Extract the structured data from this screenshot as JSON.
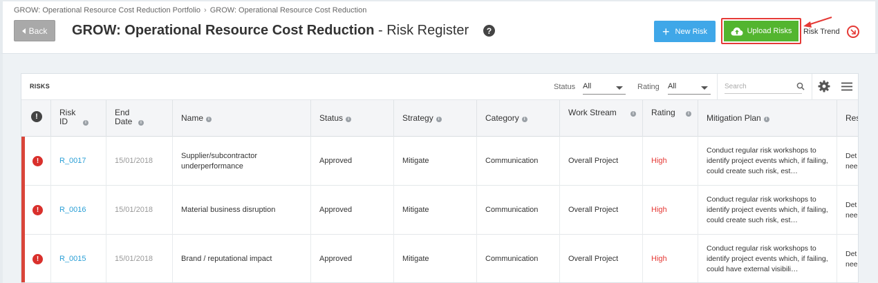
{
  "breadcrumb": [
    "GROW: Operational Resource Cost Reduction Portfolio",
    "GROW: Operational Resource Cost Reduction"
  ],
  "breadcrumb_sep": "›",
  "header": {
    "back_label": "Back",
    "title_bold": "GROW: Operational Resource Cost Reduction",
    "title_rest": " - Risk Register",
    "help_glyph": "?",
    "new_risk_label": "New Risk",
    "upload_label": "Upload Risks",
    "risk_trend_label": "Risk Trend"
  },
  "toolbar": {
    "risks_label": "RISKS",
    "status_label": "Status",
    "status_value": "All",
    "rating_label": "Rating",
    "rating_value": "All",
    "search_placeholder": "Search"
  },
  "columns": {
    "risk_id": "Risk ID",
    "end_date": "End Date",
    "name": "Name",
    "status": "Status",
    "strategy": "Strategy",
    "category": "Category",
    "work_stream": "Work Stream",
    "rating": "Rating",
    "mitigation": "Mitigation Plan",
    "res": "Res"
  },
  "rows": [
    {
      "id": "R_0017",
      "end_date": "15/01/2018",
      "name": "Supplier/subcontractor underperformance",
      "status": "Approved",
      "strategy": "Mitigate",
      "category": "Communication",
      "work_stream": "Overall Project",
      "rating": "High",
      "mitigation": "Conduct regular risk workshops to identify project events which, if failing, could create such risk, est…",
      "res": "Det nee"
    },
    {
      "id": "R_0016",
      "end_date": "15/01/2018",
      "name": "Material business disruption",
      "status": "Approved",
      "strategy": "Mitigate",
      "category": "Communication",
      "work_stream": "Overall Project",
      "rating": "High",
      "mitigation": "Conduct regular risk workshops to identify project events which, if failing, could create such risk, est…",
      "res": "Det nee"
    },
    {
      "id": "R_0015",
      "end_date": "15/01/2018",
      "name": "Brand / reputational impact",
      "status": "Approved",
      "strategy": "Mitigate",
      "category": "Communication",
      "work_stream": "Overall Project",
      "rating": "High",
      "mitigation": "Conduct regular risk workshops to identify project events which, if failing, could have external visibili…",
      "res": "Det nee"
    }
  ],
  "colors": {
    "accent_blue": "#3fa7e8",
    "upload_green": "#53b52f",
    "high_red": "#e53935",
    "highlight_red": "#e53935"
  },
  "icons": [
    "back-arrow-icon",
    "help-icon",
    "plus-icon",
    "cloud-upload-icon",
    "annotation-arrow-icon",
    "risk-trend-icon",
    "search-icon",
    "gear-icon",
    "menu-icon",
    "alert-icon",
    "info-icon"
  ]
}
